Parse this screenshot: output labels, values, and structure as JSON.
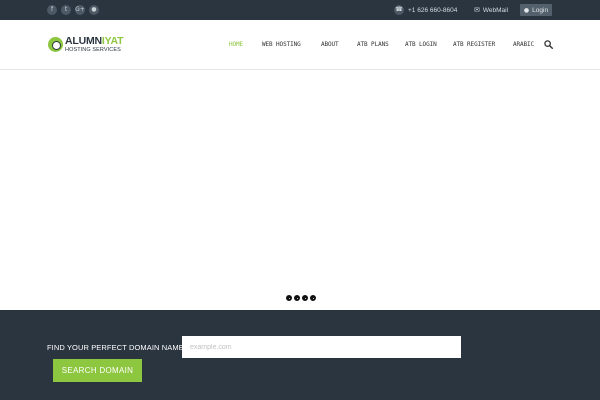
{
  "topbar": {
    "social": [
      {
        "name": "facebook-icon",
        "glyph": "f"
      },
      {
        "name": "twitter-icon",
        "glyph": "t"
      },
      {
        "name": "google-plus-icon",
        "glyph": "G+"
      },
      {
        "name": "rss-icon",
        "glyph": "●"
      }
    ],
    "phone": "+1 626 660-8604",
    "webmail": "WebMail",
    "login": "Login"
  },
  "logo": {
    "name_main": "ALUMN",
    "name_accent": "IYAT",
    "subtitle": "HOSTING SERVICES"
  },
  "nav": {
    "items": [
      "HOME",
      "WEB HOSTING",
      "ABOUT",
      "ATB PLANS",
      "ATB LOGIN",
      "ATB REGISTER",
      "ARABIC"
    ],
    "active_index": 0
  },
  "slider": {
    "dot_count": 4
  },
  "domain": {
    "label": "FIND YOUR PERFECT DOMAIN NAME:",
    "placeholder": "example.com",
    "value": "",
    "button": "SEARCH DOMAIN"
  },
  "colors": {
    "accent": "#8dc63f",
    "dark": "#2a3540"
  }
}
